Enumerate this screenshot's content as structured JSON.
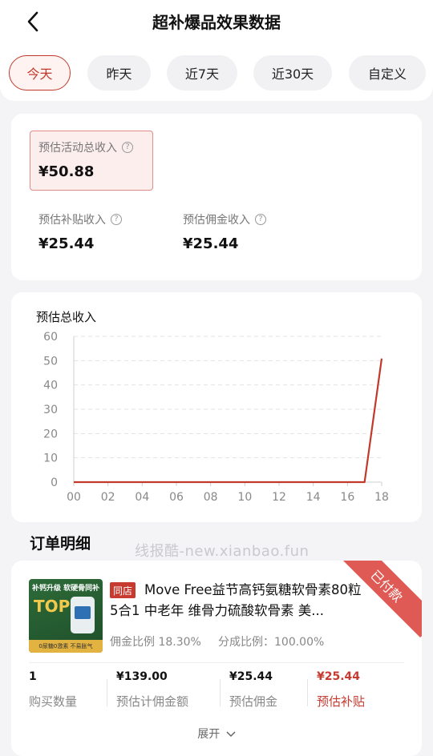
{
  "header": {
    "title": "超补爆品效果数据"
  },
  "tabs": [
    {
      "label": "今天",
      "active": true
    },
    {
      "label": "昨天",
      "active": false
    },
    {
      "label": "近7天",
      "active": false
    },
    {
      "label": "近30天",
      "active": false
    },
    {
      "label": "自定义",
      "active": false
    }
  ],
  "summary": {
    "total": {
      "label": "预估活动总收入",
      "value": "¥50.88"
    },
    "subsidy": {
      "label": "预估补贴收入",
      "value": "¥25.44"
    },
    "commission": {
      "label": "预估佣金收入",
      "value": "¥25.44"
    }
  },
  "chart_data": {
    "type": "line",
    "title": "预估总收入",
    "x_ticks": [
      "00",
      "02",
      "04",
      "06",
      "08",
      "10",
      "12",
      "14",
      "16",
      "18"
    ],
    "y_ticks": [
      0,
      10,
      20,
      30,
      40,
      50,
      60
    ],
    "ylim": [
      0,
      60
    ],
    "xlim": [
      0,
      18
    ],
    "grid": true,
    "color": "#c0392b",
    "series": [
      {
        "x": [
          0,
          1,
          2,
          3,
          4,
          5,
          6,
          7,
          8,
          9,
          10,
          11,
          12,
          13,
          14,
          15,
          16,
          17,
          18
        ],
        "y": [
          0,
          0,
          0,
          0,
          0,
          0,
          0,
          0,
          0,
          0,
          0,
          0,
          0,
          0,
          0,
          0,
          0,
          0,
          50.88
        ]
      }
    ]
  },
  "orders": {
    "section_title": "订单明细",
    "watermark": "线报酷-new.xianbao.fun",
    "item": {
      "store_tag": "同店",
      "title": "Move Free益节高钙氨糖软骨素80粒 5合1 中老年 维骨力硫酸软骨素 美...",
      "commission_ratio": "佣金比例 18.30%",
      "share_ratio": "分成比例：100.00%",
      "status": "已付款",
      "image": {
        "headline": "补钙升级 软硬骨同补",
        "badge": "TOP1",
        "footer": "0尿糖0激素 不易胀气"
      },
      "stats": [
        {
          "value": "1",
          "label": "购买数量"
        },
        {
          "value": "¥139.00",
          "label": "预估计佣金额"
        },
        {
          "value": "¥25.44",
          "label": "预估佣金"
        },
        {
          "value": "¥25.44",
          "label": "预估补贴"
        }
      ],
      "expand_label": "展开"
    }
  }
}
